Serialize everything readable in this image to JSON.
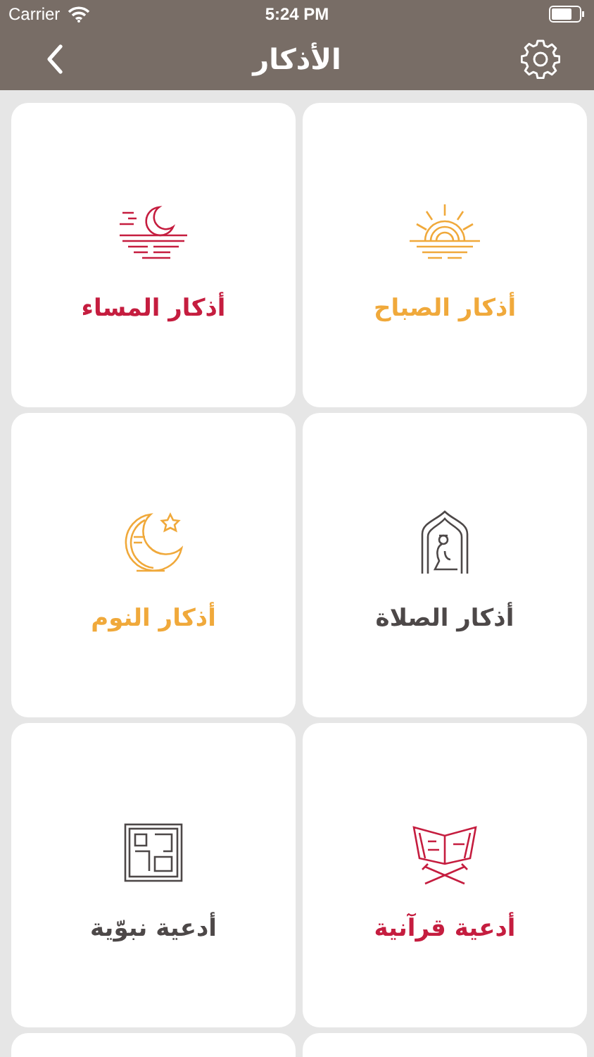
{
  "status_bar": {
    "carrier": "Carrier",
    "time": "5:24 PM"
  },
  "nav": {
    "title": "الأذكار"
  },
  "items": [
    {
      "label": "أذكار الصباح",
      "color": "#f0a93b"
    },
    {
      "label": "أذكار المساء",
      "color": "#c51d3f"
    },
    {
      "label": "أذكار الصلاة",
      "color": "#4d4848"
    },
    {
      "label": "أذكار النوم",
      "color": "#f0a93b"
    },
    {
      "label": "أدعية قرآنية",
      "color": "#c51d3f"
    },
    {
      "label": "أدعية نبوّية",
      "color": "#4d4848"
    }
  ]
}
